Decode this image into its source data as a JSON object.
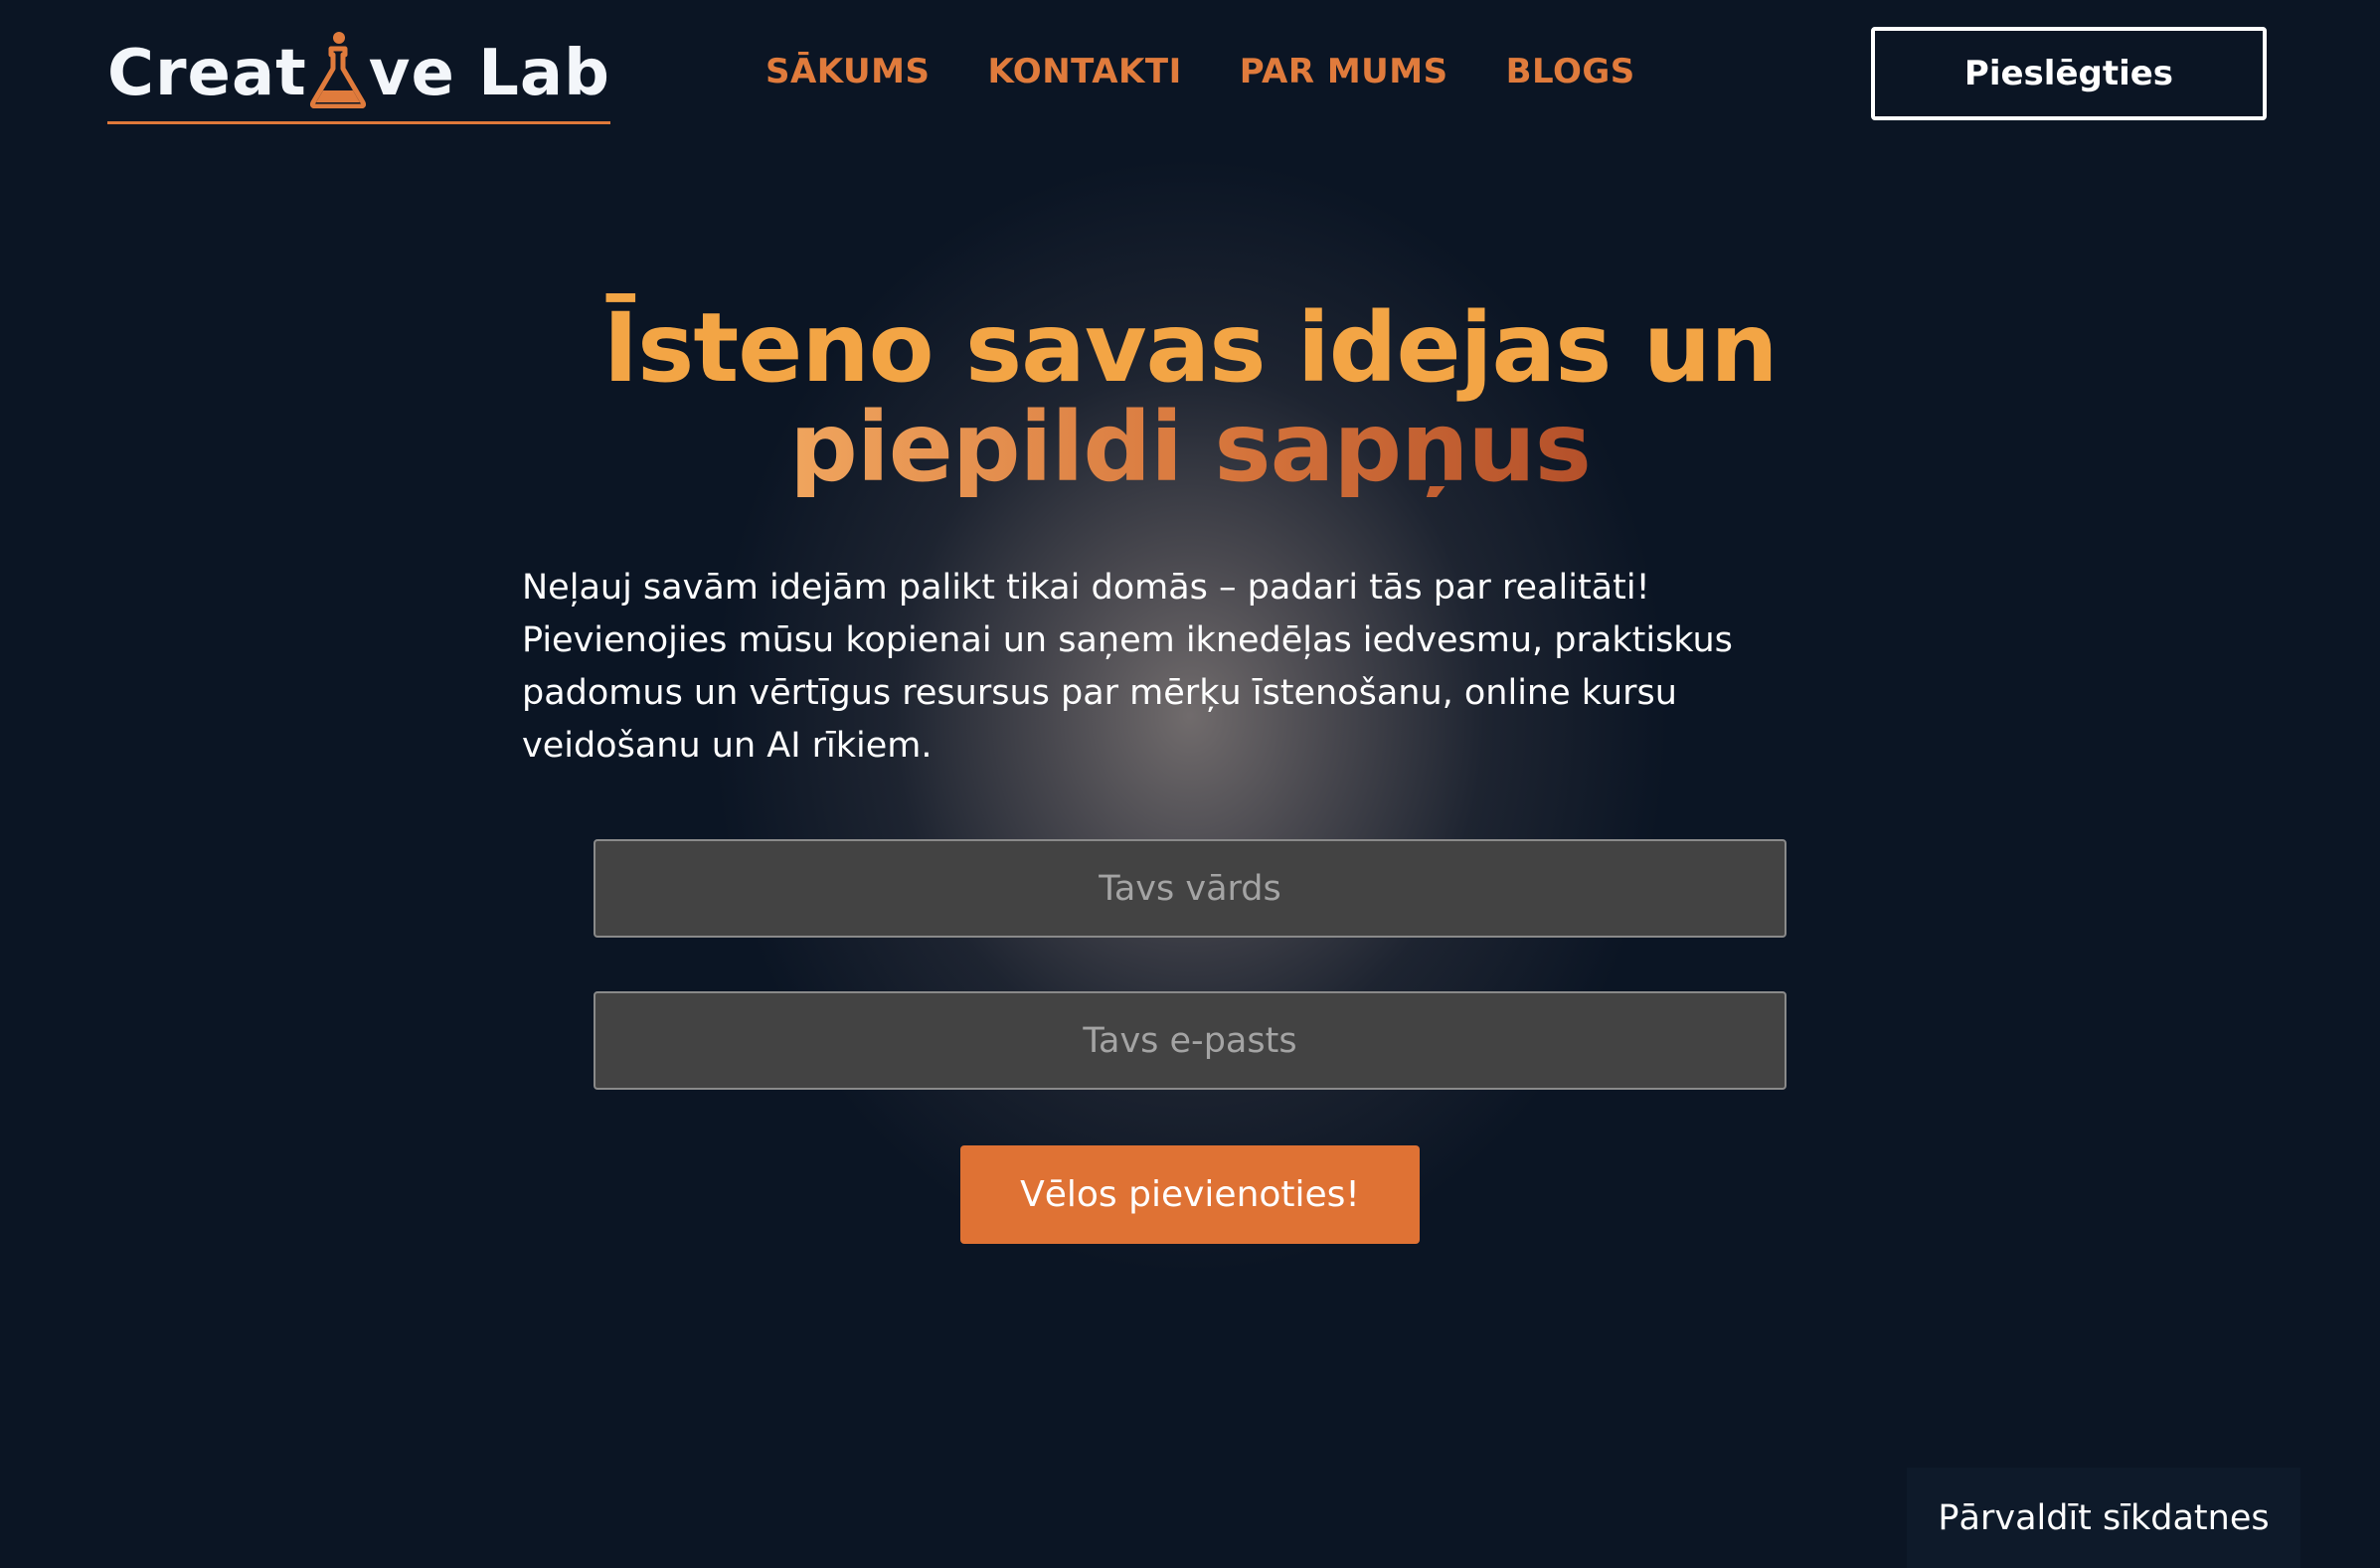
{
  "brand": {
    "logo_prefix": "Creat",
    "logo_suffix": "ve Lab",
    "logo_icon": "flask-icon",
    "accent_color": "#e07b3c",
    "background_color": "#0b1524"
  },
  "nav": {
    "items": [
      {
        "label": "SĀKUMS"
      },
      {
        "label": "KONTAKTI"
      },
      {
        "label": "PAR MUMS"
      },
      {
        "label": "BLOGS"
      }
    ]
  },
  "header": {
    "login_label": "Pieslēgties"
  },
  "hero": {
    "title_line1": "Īsteno savas idejas un",
    "title_line2": "piepildi sapņus",
    "description": "Neļauj savām idejām palikt tikai domās – padari tās par realitāti! Pievienojies mūsu kopienai un saņem iknedēļas iedvesmu, praktiskus padomus un vērtīgus resursus par mērķu īstenošanu, online kursu veidošanu un AI rīkiem."
  },
  "form": {
    "name_placeholder": "Tavs vārds",
    "name_value": "",
    "email_placeholder": "Tavs e-pasts",
    "email_value": "",
    "submit_label": "Vēlos pievienoties!"
  },
  "cookie": {
    "label": "Pārvaldīt sīkdatnes"
  }
}
